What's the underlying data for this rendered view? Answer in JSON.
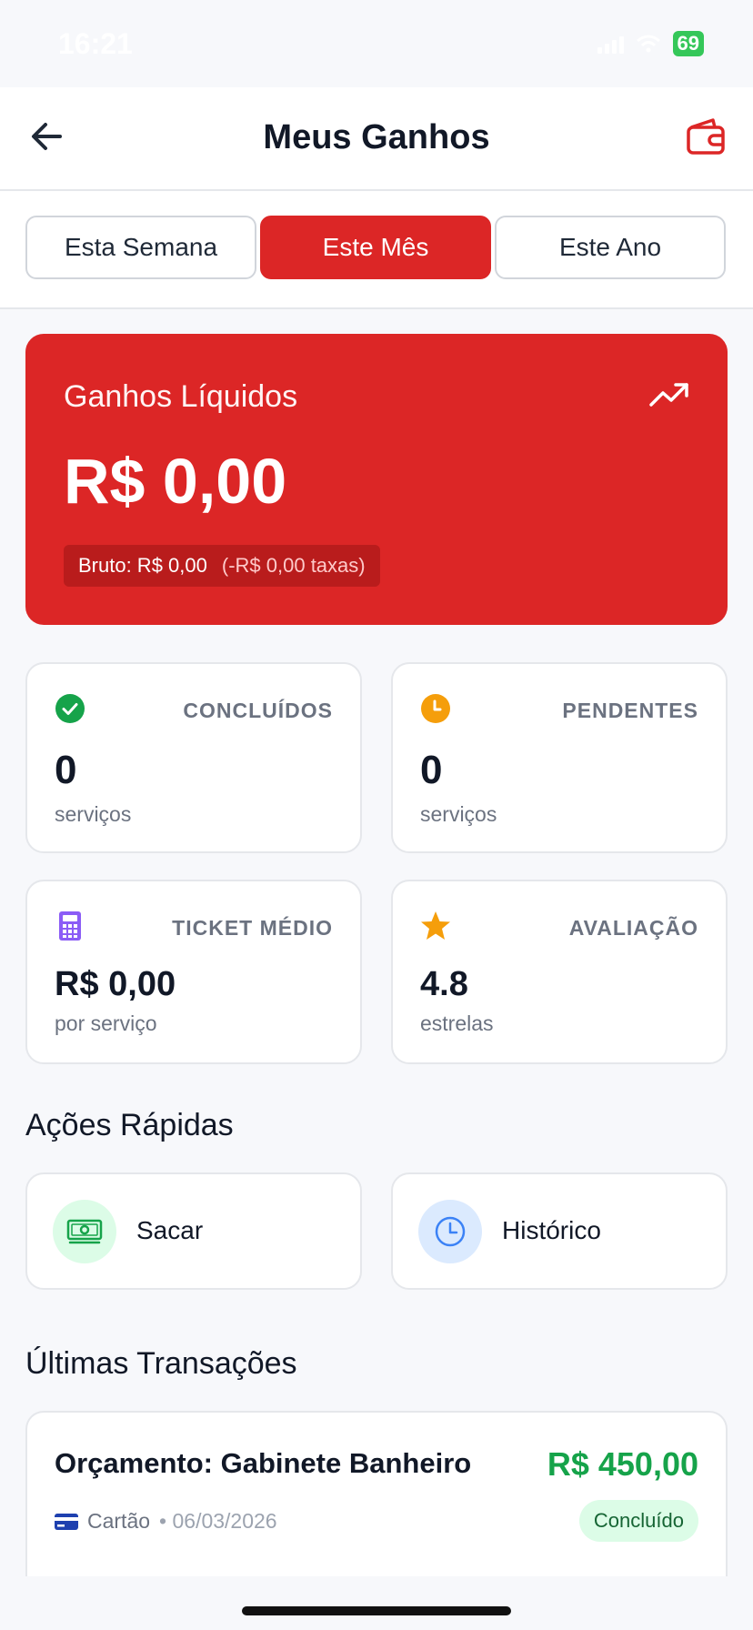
{
  "status_bar": {
    "time": "16:21",
    "battery": "69"
  },
  "header": {
    "title": "Meus Ganhos"
  },
  "period_tabs": [
    {
      "label": "Esta Semana",
      "active": false
    },
    {
      "label": "Este Mês",
      "active": true
    },
    {
      "label": "Este Ano",
      "active": false
    }
  ],
  "earnings": {
    "label": "Ganhos Líquidos",
    "amount": "R$ 0,00",
    "gross": "Bruto: R$ 0,00",
    "fees": "(-R$ 0,00 taxas)"
  },
  "stats": [
    {
      "label": "CONCLUÍDOS",
      "value": "0",
      "sub": "serviços",
      "icon": "check-circle-icon",
      "color": "#16a34a"
    },
    {
      "label": "PENDENTES",
      "value": "0",
      "sub": "serviços",
      "icon": "clock-icon",
      "color": "#f59e0b"
    },
    {
      "label": "TICKET MÉDIO",
      "value": "R$ 0,00",
      "sub": "por serviço",
      "icon": "calculator-icon",
      "color": "#8b5cf6"
    },
    {
      "label": "AVALIAÇÃO",
      "value": "4.8",
      "sub": "estrelas",
      "icon": "star-icon",
      "color": "#f59e0b"
    }
  ],
  "quick_actions": {
    "title": "Ações Rápidas",
    "items": [
      {
        "label": "Sacar",
        "icon": "cash-icon",
        "color": "#16a34a"
      },
      {
        "label": "Histórico",
        "icon": "clock-icon",
        "color": "#3b82f6"
      }
    ]
  },
  "transactions": {
    "title": "Últimas Transações",
    "items": [
      {
        "title": "Orçamento: Gabinete Banheiro",
        "amount": "R$ 450,00",
        "method": "Cartão",
        "date": "• 06/03/2026",
        "status": "Concluído"
      }
    ]
  }
}
